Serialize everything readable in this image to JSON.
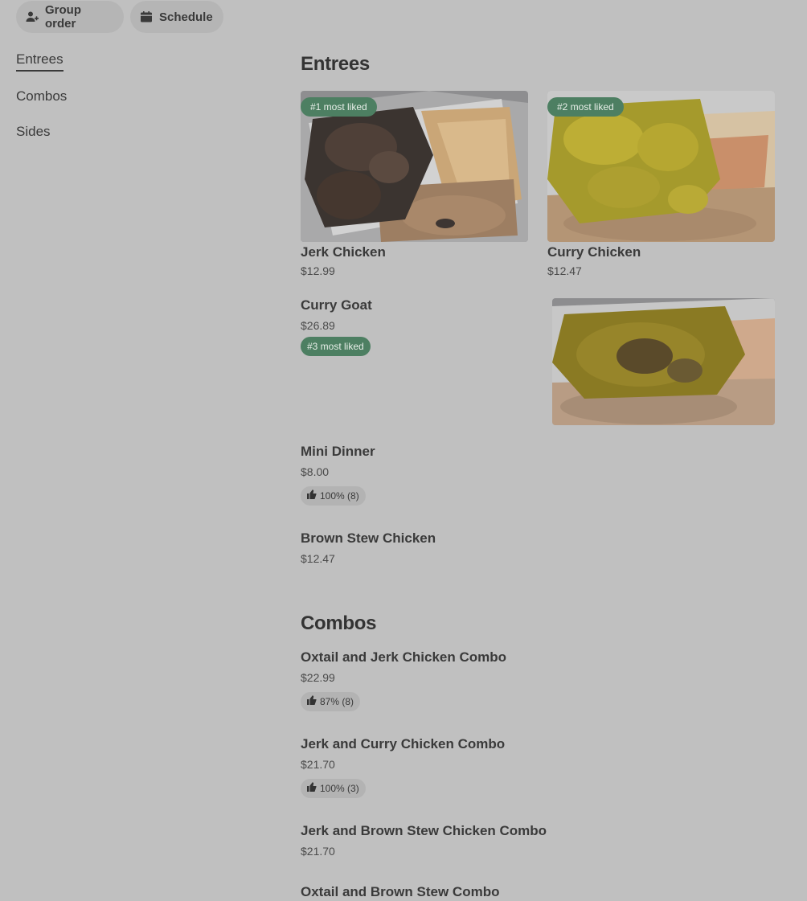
{
  "top_buttons": {
    "group_order": "Group order",
    "schedule": "Schedule"
  },
  "sidebar": {
    "items": [
      {
        "label": "Entrees"
      },
      {
        "label": "Combos"
      },
      {
        "label": "Sides"
      }
    ]
  },
  "entrees": {
    "title": "Entrees",
    "featured": [
      {
        "name": "Jerk Chicken",
        "price": "$12.99",
        "badge": "#1 most liked"
      },
      {
        "name": "Curry Chicken",
        "price": "$12.47",
        "badge": "#2 most liked"
      }
    ],
    "curry_goat": {
      "name": "Curry Goat",
      "price": "$26.89",
      "badge": "#3 most liked"
    },
    "mini_dinner": {
      "name": "Mini Dinner",
      "price": "$8.00",
      "rating": "100% (8)"
    },
    "brown_stew": {
      "name": "Brown Stew Chicken",
      "price": "$12.47"
    }
  },
  "combos": {
    "title": "Combos",
    "items": [
      {
        "name": "Oxtail and Jerk Chicken Combo",
        "price": "$22.99",
        "rating": "87% (8)"
      },
      {
        "name": "Jerk and Curry Chicken Combo",
        "price": "$21.70",
        "rating": "100% (3)"
      },
      {
        "name": "Jerk and Brown Stew Chicken Combo",
        "price": "$21.70"
      },
      {
        "name": "Oxtail and Brown Stew Combo"
      }
    ]
  },
  "icons": {
    "group": "person-add-icon",
    "schedule": "calendar-icon",
    "thumbs": "thumbs-up-icon"
  },
  "colors": {
    "background": "#c0c0c0",
    "badge": "#4d7f62",
    "chip": "#b3b3b3"
  }
}
